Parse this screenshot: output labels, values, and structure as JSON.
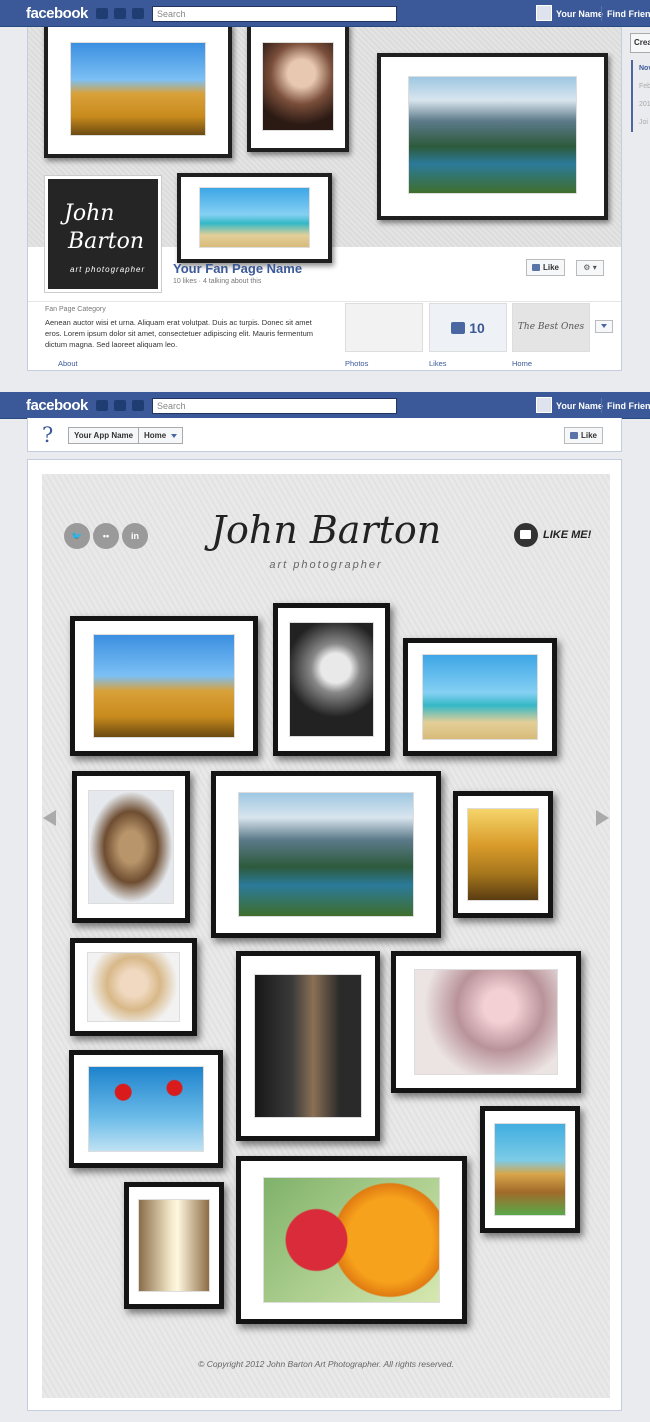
{
  "topbar": {
    "logo": "facebook",
    "search_placeholder": "Search",
    "user_name": "Your Name",
    "find_friends": "Find Friends"
  },
  "timeline": {
    "logo_name_line1": "John",
    "logo_name_line2": "Barton",
    "logo_tagline": "art photographer",
    "page_name": "Your Fan Page Name",
    "page_stats": "10 likes · 4 talking about this",
    "like_button": "Like",
    "category": "Fan Page Category",
    "description": "Aenean auctor wisi et urna. Aliquam erat volutpat. Duis ac turpis. Donec sit amet eros. Lorem ipsum dolor sit amet, consectetuer adipiscing elit. Mauris fermentum dictum magna. Sed laoreet aliquam leo.",
    "likes_count": "10",
    "app_tile_label": "The Best Ones",
    "tabs": {
      "about": "About",
      "photos": "Photos",
      "likes": "Likes",
      "home": "Home"
    }
  },
  "right_column": {
    "create_button": "Crea",
    "items": [
      "Nov",
      "Feb",
      "201",
      "Joi"
    ]
  },
  "app_header": {
    "app_name": "Your App Name",
    "home_tab": "Home",
    "like_button": "Like"
  },
  "app_page": {
    "title": "John Barton",
    "subtitle": "art photographer",
    "like_me": "LIKE ME!",
    "social": {
      "flickr": "••",
      "linkedin": "in"
    },
    "copyright": "© Copyright 2012 John Barton Art Photographer. All rights reserved."
  },
  "icons": {
    "search": "search-icon",
    "thumbs_up": "thumbs-up-icon",
    "gear": "gear-icon",
    "chevron_down": "chevron-down-icon",
    "help": "help-icon",
    "arrow_left": "arrow-left-icon",
    "arrow_right": "arrow-right-icon",
    "twitter": "twitter-icon",
    "flickr": "flickr-icon",
    "linkedin": "linkedin-icon"
  },
  "colors": {
    "brand_blue": "#3b5998",
    "frame_black": "#141414",
    "link_blue": "#3b5998"
  }
}
